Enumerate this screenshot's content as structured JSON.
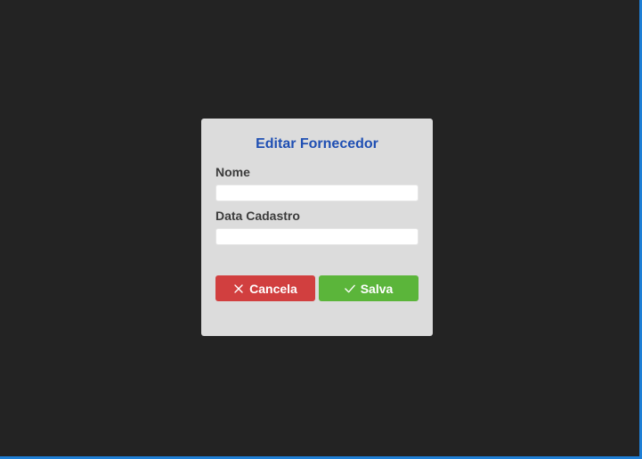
{
  "dialog": {
    "title": "Editar Fornecedor",
    "fields": [
      {
        "label": "Nome",
        "value": "",
        "placeholder": ""
      },
      {
        "label": "Data Cadastro",
        "value": "",
        "placeholder": ""
      }
    ],
    "buttons": {
      "cancel": {
        "label": "Cancela",
        "icon": "close-icon",
        "color": "#d13f3f"
      },
      "save": {
        "label": "Salva",
        "icon": "check-icon",
        "color": "#5bb53a"
      }
    }
  },
  "colors": {
    "background": "#232323",
    "dialog_background": "#dcdcdc",
    "title": "#1f4fb3",
    "frame_accent": "#1e7fd6"
  }
}
